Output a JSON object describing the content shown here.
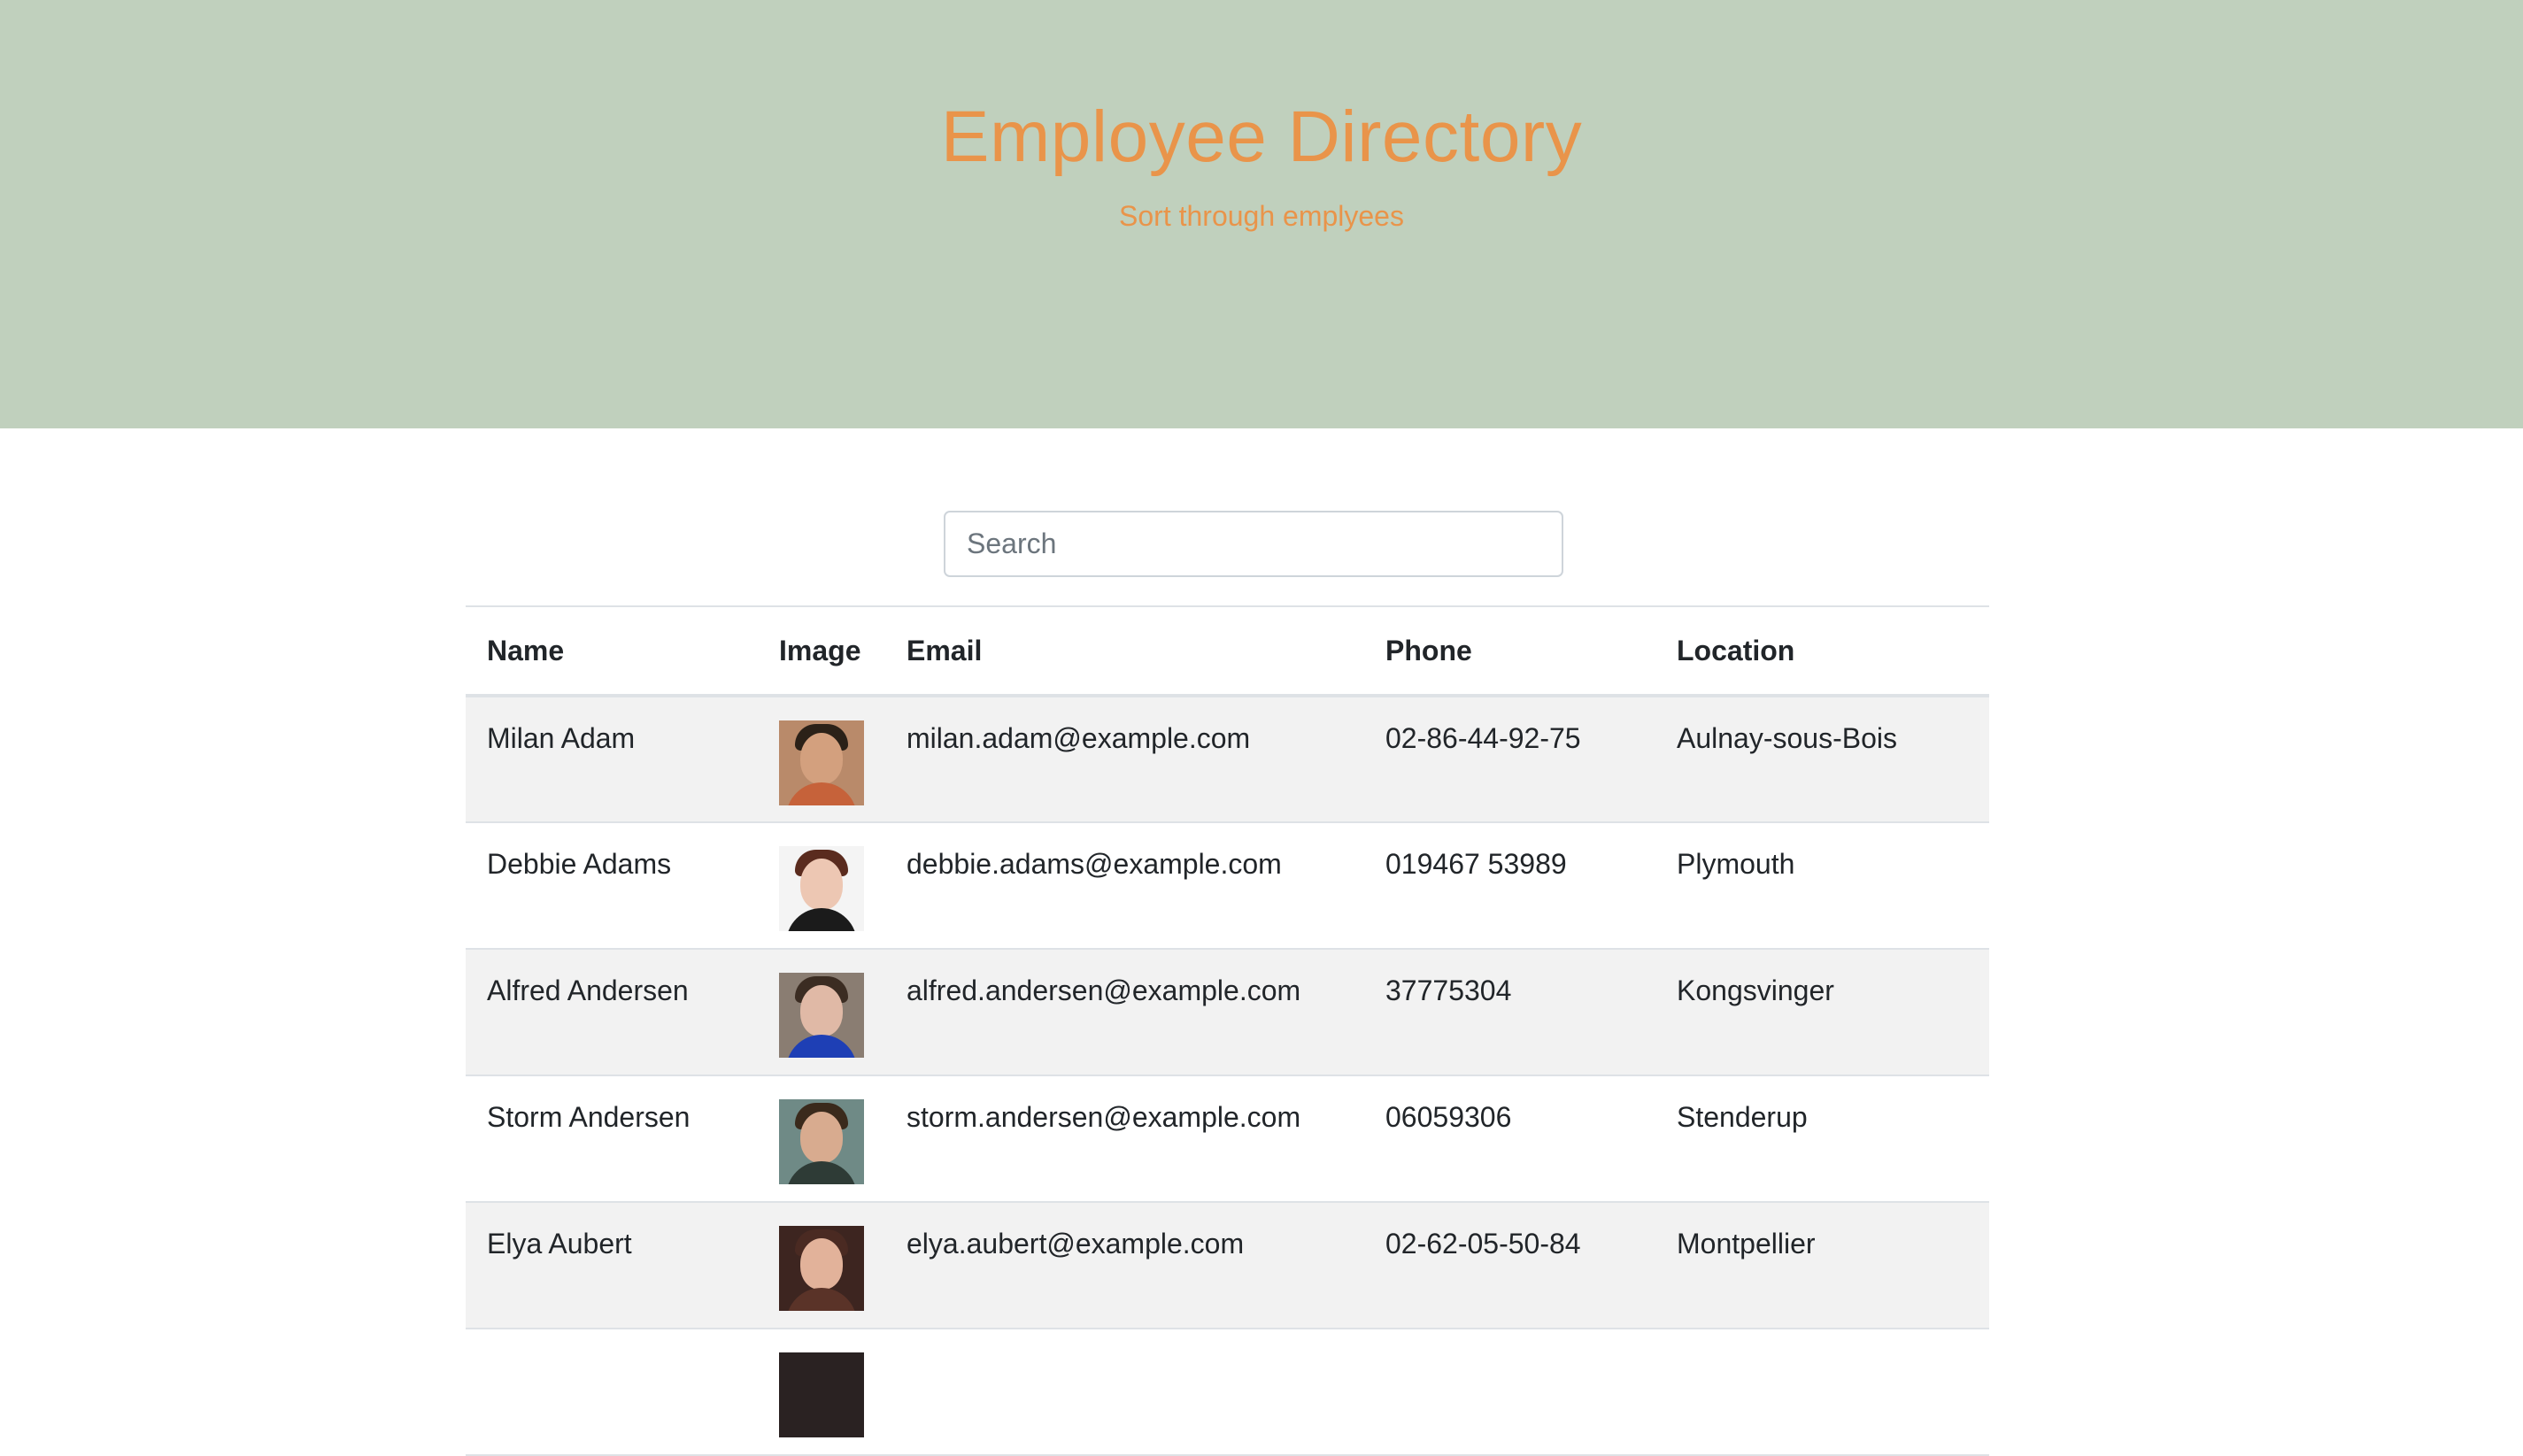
{
  "header": {
    "title": "Employee Directory",
    "subtitle": "Sort through emplyees"
  },
  "search": {
    "placeholder": "Search",
    "value": ""
  },
  "table": {
    "columns": [
      "Name",
      "Image",
      "Email",
      "Phone",
      "Location"
    ],
    "rows": [
      {
        "name": "Milan Adam",
        "image": "portrait-photo",
        "email": "milan.adam@example.com",
        "phone": "02-86-44-92-75",
        "location": "Aulnay-sous-Bois"
      },
      {
        "name": "Debbie Adams",
        "image": "portrait-photo",
        "email": "debbie.adams@example.com",
        "phone": "019467 53989",
        "location": "Plymouth"
      },
      {
        "name": "Alfred Andersen",
        "image": "portrait-photo",
        "email": "alfred.andersen@example.com",
        "phone": "37775304",
        "location": "Kongsvinger"
      },
      {
        "name": "Storm Andersen",
        "image": "portrait-photo",
        "email": "storm.andersen@example.com",
        "phone": "06059306",
        "location": "Stenderup"
      },
      {
        "name": "Elya Aubert",
        "image": "portrait-photo",
        "email": "elya.aubert@example.com",
        "phone": "02-62-05-50-84",
        "location": "Montpellier"
      }
    ]
  },
  "colors": {
    "hero_background": "#c0d0bd",
    "hero_text": "#e9944a",
    "row_stripe": "#f2f2f2"
  }
}
